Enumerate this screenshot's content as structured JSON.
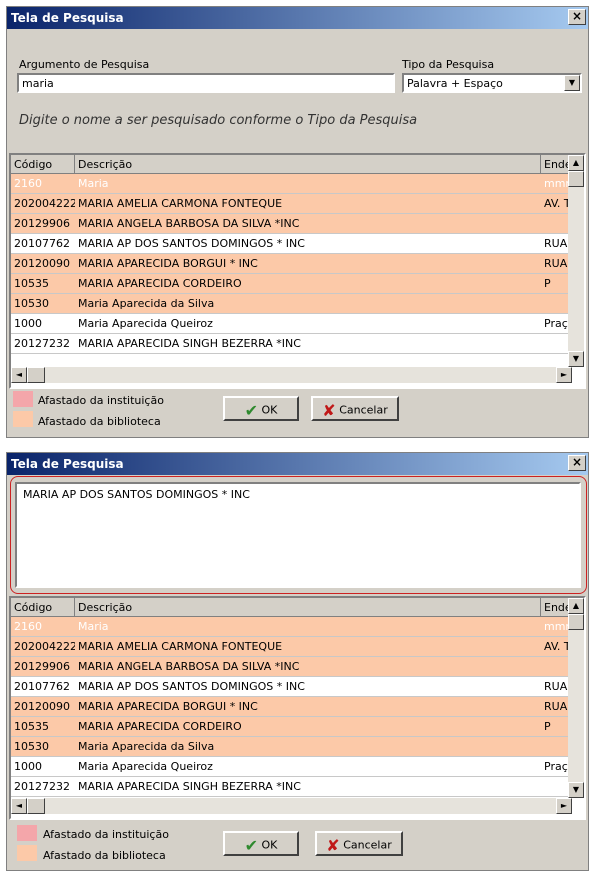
{
  "colors": {
    "orange_row": "#fcc9a8",
    "white_row": "#ffffff",
    "pink_swatch": "#f4a6aa",
    "orange_swatch": "#fcc9a8",
    "first_row_text": "#ffffff",
    "ok_check": "#2f8a2f",
    "cancel_x": "#c01818"
  },
  "window1": {
    "title": "Tela de Pesquisa",
    "close": "×",
    "search_label": "Argumento de Pesquisa",
    "search_value": "maria",
    "type_label": "Tipo da Pesquisa",
    "type_value": "Palavra + Espaço",
    "hint": "Digite o nome a ser pesquisado conforme o Tipo da Pesquisa"
  },
  "window2": {
    "title": "Tela de Pesquisa",
    "close": "×",
    "memo_text": "MARIA AP DOS SANTOS DOMINGOS * INC"
  },
  "grid": {
    "columns": [
      "Código",
      "Descrição",
      "Ender"
    ],
    "rows": [
      {
        "code": "2160",
        "desc": "Maria",
        "addr": "mmmd"
      },
      {
        "code": "202004222",
        "desc": "MARIA AMELIA CARMONA FONTEQUE",
        "addr": "AV. T"
      },
      {
        "code": "20129906",
        "desc": "MARIA ANGELA BARBOSA DA SILVA *INC",
        "addr": ""
      },
      {
        "code": "20107762",
        "desc": "MARIA AP DOS SANTOS DOMINGOS * INC",
        "addr": "RUA I"
      },
      {
        "code": "20120090",
        "desc": "MARIA APARECIDA BORGUI * INC",
        "addr": "RUA :"
      },
      {
        "code": "10535",
        "desc": "MARIA APARECIDA CORDEIRO",
        "addr": "P"
      },
      {
        "code": "10530",
        "desc": "Maria Aparecida da Silva",
        "addr": ""
      },
      {
        "code": "1000",
        "desc": "Maria Aparecida Queiroz",
        "addr": "Praça"
      },
      {
        "code": "20127232",
        "desc": "MARIA APARECIDA SINGH BEZERRA *INC",
        "addr": ""
      }
    ],
    "row_colors": [
      "orange",
      "orange",
      "orange",
      "white",
      "orange",
      "orange",
      "orange",
      "white",
      "white"
    ]
  },
  "grid2_overlap_row": {
    "code": "20107762",
    "desc": "MARIA AP DOS SANTOS DOMINGOS * INC",
    "addr": "RUA I"
  },
  "legend": {
    "instituicao": "Afastado da instituição",
    "biblioteca": "Afastado da biblioteca"
  },
  "buttons": {
    "ok": "OK",
    "cancel": "Cancelar",
    "ok_icon": "✔",
    "cancel_icon": "✘"
  },
  "scroll_icons": {
    "up": "▲",
    "down": "▼",
    "left": "◄",
    "right": "►",
    "dropdown": "▼"
  }
}
